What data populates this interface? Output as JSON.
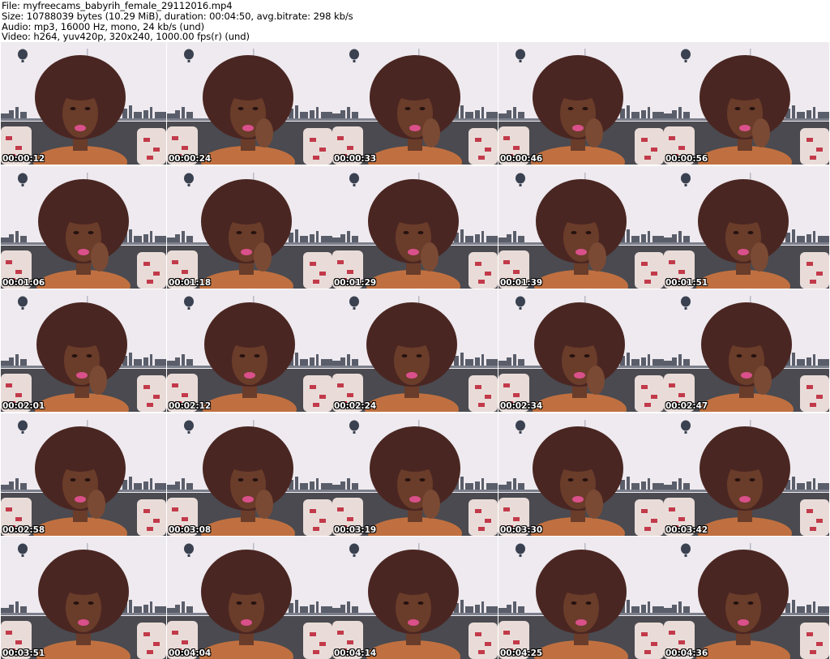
{
  "header": {
    "file": "File: myfreecams_babyrih_female_29112016.mp4",
    "size": "Size: 10788039 bytes (10.29 MiB), duration: 00:04:50, avg.bitrate: 298 kb/s",
    "audio": "Audio: mp3, 16000 Hz, mono, 24 kb/s (und)",
    "video": "Video: h264, yuv420p, 320x240, 1000.00 fps(r) (und)"
  },
  "thumbnails": [
    {
      "timestamp": "00:00:12"
    },
    {
      "timestamp": "00:00:24"
    },
    {
      "timestamp": "00:00:33"
    },
    {
      "timestamp": "00:00:46"
    },
    {
      "timestamp": "00:00:56"
    },
    {
      "timestamp": "00:01:06"
    },
    {
      "timestamp": "00:01:18"
    },
    {
      "timestamp": "00:01:29"
    },
    {
      "timestamp": "00:01:39"
    },
    {
      "timestamp": "00:01:51"
    },
    {
      "timestamp": "00:02:01"
    },
    {
      "timestamp": "00:02:12"
    },
    {
      "timestamp": "00:02:24"
    },
    {
      "timestamp": "00:02:34"
    },
    {
      "timestamp": "00:02:47"
    },
    {
      "timestamp": "00:02:58"
    },
    {
      "timestamp": "00:03:08"
    },
    {
      "timestamp": "00:03:19"
    },
    {
      "timestamp": "00:03:30"
    },
    {
      "timestamp": "00:03:42"
    },
    {
      "timestamp": "00:03:51"
    },
    {
      "timestamp": "00:04:04"
    },
    {
      "timestamp": "00:04:14"
    },
    {
      "timestamp": "00:04:25"
    },
    {
      "timestamp": "00:04:36"
    }
  ],
  "colors": {
    "wall": "#eeeaef",
    "skyline": "#5a5e6a",
    "sofa": "#4a4a50",
    "pillow": "#e9dcd8",
    "pillow_pattern": "#c23a4a",
    "hair": "#4a2622",
    "skin": "#6a3c2a",
    "lips": "#d9508a",
    "shoulder": "#c07040",
    "balloon": "#3a4150"
  }
}
